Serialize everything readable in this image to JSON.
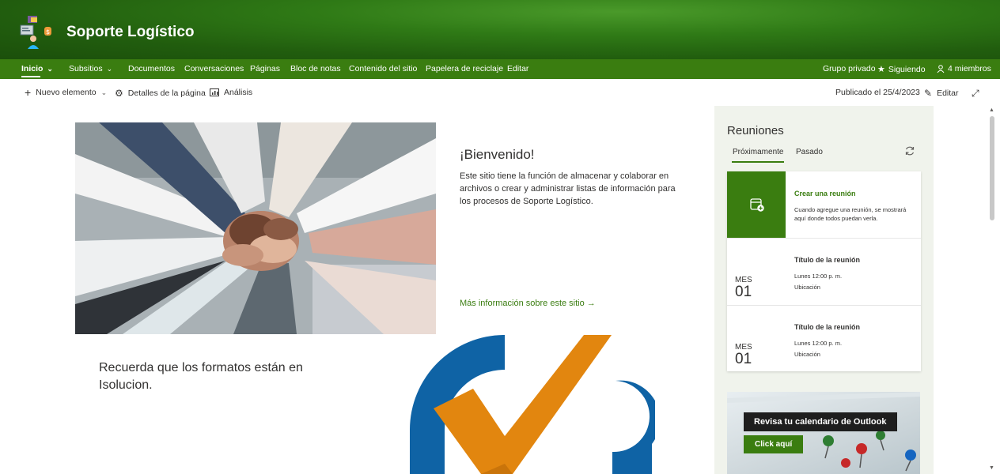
{
  "site": {
    "title": "Soporte Logístico"
  },
  "nav": {
    "items": [
      {
        "label": "Inicio",
        "chevron": "⌄"
      },
      {
        "label": "Subsitios",
        "chevron": "⌄"
      },
      {
        "label": "Documentos"
      },
      {
        "label": "Conversaciones"
      },
      {
        "label": "Páginas"
      },
      {
        "label": "Bloc de notas"
      },
      {
        "label": "Contenido del sitio"
      },
      {
        "label": "Papelera de reciclaje"
      },
      {
        "label": "Editar"
      }
    ],
    "right": {
      "group": "Grupo privado",
      "following": "Siguiendo",
      "members": "4 miembros"
    }
  },
  "commandbar": {
    "new_item": "Nuevo elemento",
    "page_details": "Detalles de la página",
    "analytics": "Análisis",
    "published": "Publicado el 25/4/2023",
    "edit": "Editar"
  },
  "welcome": {
    "title": "¡Bienvenido!",
    "text": "Este sitio tiene la función de almacenar y colaborar en archivos o crear y administrar listas de información para los procesos de Soporte Logístico.",
    "link": "Más información sobre este sitio"
  },
  "reminder": "Recuerda que los formatos están en Isolucion.",
  "meetings": {
    "title": "Reuniones",
    "tabs": [
      "Próximamente",
      "Pasado"
    ],
    "create": {
      "title": "Crear una reunión",
      "subtitle": "Cuando agregue una reunión, se mostrará aquí donde todos puedan verla."
    },
    "items": [
      {
        "month": "MES",
        "day": "01",
        "title": "Título de la reunión",
        "time": "Lunes 12:00 p. m.",
        "location": "Ubicación"
      },
      {
        "month": "MES",
        "day": "01",
        "title": "Título de la reunión",
        "time": "Lunes 12:00 p. m.",
        "location": "Ubicación"
      }
    ]
  },
  "outlook": {
    "title": "Revisa tu calendario de Outlook",
    "button": "Click aquí"
  },
  "colors": {
    "brand_green": "#3a7d10",
    "header_dark_green": "#215d0e",
    "panel_bg": "#f0f3ec"
  }
}
